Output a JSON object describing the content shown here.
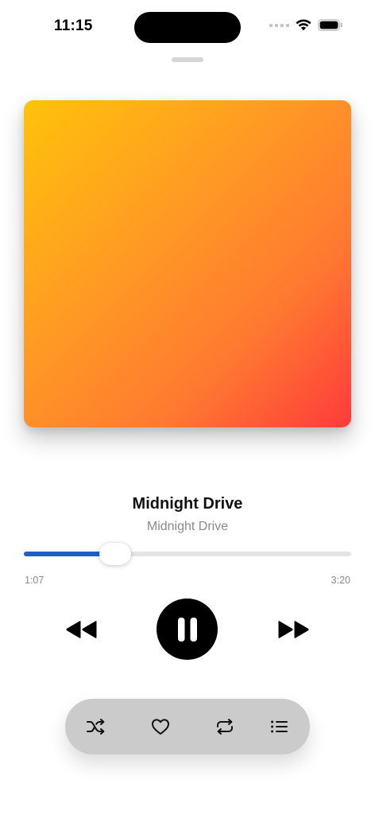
{
  "status_bar": {
    "time": "11:15"
  },
  "now_playing": {
    "title": "Midnight Drive",
    "artist": "Midnight Drive",
    "elapsed": "1:07",
    "duration": "3:20",
    "progress_fraction": 0.28,
    "artwork_gradient": [
      "#ffc20a",
      "#ff9a24",
      "#ff7a30",
      "#ff3b3b"
    ]
  },
  "controls": {
    "rewind_icon": "backward-icon",
    "play_pause_icon": "pause-icon",
    "forward_icon": "forward-icon",
    "state": "playing"
  },
  "toolbar": {
    "items": [
      {
        "icon": "shuffle-icon"
      },
      {
        "icon": "heart-icon"
      },
      {
        "icon": "repeat-icon"
      },
      {
        "icon": "list-icon"
      }
    ]
  },
  "colors": {
    "accent": "#1c5fc6",
    "play_button": "#000000",
    "toolbar_bg": "#cbcbcb",
    "secondary_text": "#8a8a8a"
  }
}
